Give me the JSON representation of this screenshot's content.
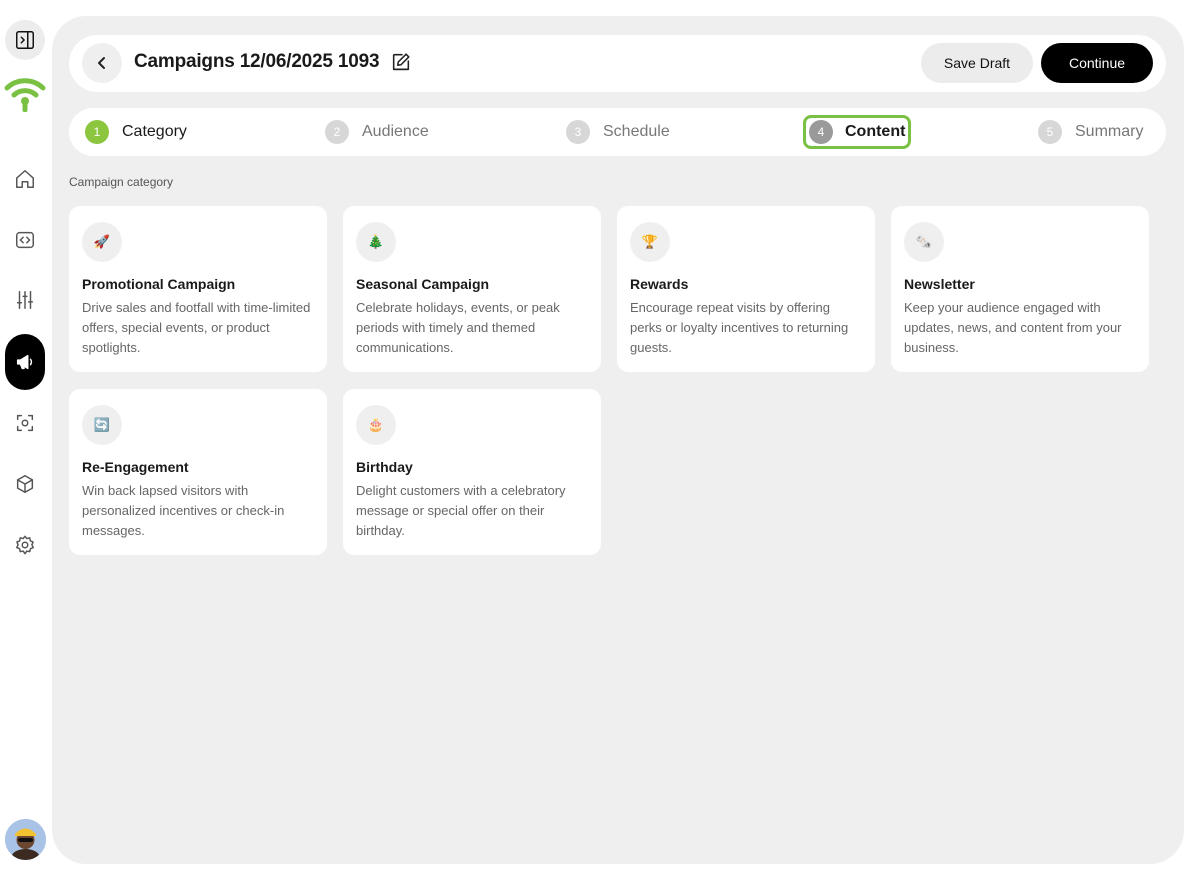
{
  "header": {
    "title": "Campaigns 12/06/2025 1093",
    "save_label": "Save Draft",
    "continue_label": "Continue"
  },
  "steps": [
    {
      "number": "1",
      "label": "Category",
      "state": "done"
    },
    {
      "number": "2",
      "label": "Audience",
      "state": "pending"
    },
    {
      "number": "3",
      "label": "Schedule",
      "state": "pending"
    },
    {
      "number": "4",
      "label": "Content",
      "state": "current"
    },
    {
      "number": "5",
      "label": "Summary",
      "state": "pending"
    }
  ],
  "section_label": "Campaign category",
  "categories": [
    {
      "icon": "🚀",
      "icon_name": "rocket-icon",
      "title": "Promotional Campaign",
      "description": "Drive sales and footfall with time-limited offers, special events, or product spotlights."
    },
    {
      "icon": "🎄",
      "icon_name": "tree-icon",
      "title": "Seasonal Campaign",
      "description": "Celebrate holidays, events, or peak periods with timely and themed communications."
    },
    {
      "icon": "🏆",
      "icon_name": "trophy-icon",
      "title": "Rewards",
      "description": "Encourage repeat visits by offering perks or loyalty incentives to returning guests."
    },
    {
      "icon": "🗞️",
      "icon_name": "newspaper-icon",
      "title": "Newsletter",
      "description": "Keep your audience engaged with updates, news, and content from your business."
    },
    {
      "icon": "🔄",
      "icon_name": "refresh-icon",
      "title": "Re-Engagement",
      "description": "Win back lapsed visitors with personalized incentives or check-in messages."
    },
    {
      "icon": "🎂",
      "icon_name": "cake-icon",
      "title": "Birthday",
      "description": "Delight customers with a celebratory message or special offer on their birthday."
    }
  ],
  "sidebar": {
    "items": [
      "toggle-sidebar-icon",
      "home-icon",
      "code-icon",
      "sliders-icon",
      "megaphone-icon",
      "scan-icon",
      "cube-icon",
      "gear-icon"
    ],
    "active": "megaphone-icon"
  },
  "colors": {
    "accent_green": "#7ac143",
    "panel_bg": "#efefef",
    "primary_button": "#000000"
  }
}
